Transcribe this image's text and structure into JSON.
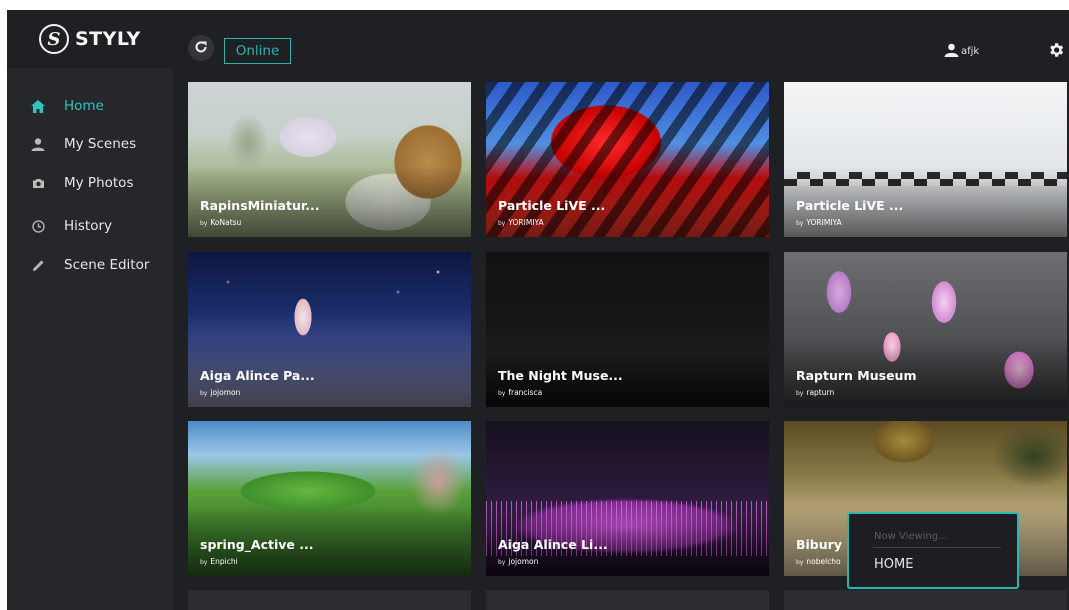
{
  "brand": {
    "logo_letter": "S",
    "name": "STYLY"
  },
  "sidebar": {
    "items": [
      {
        "label": "Home",
        "icon": "home-icon",
        "active": true
      },
      {
        "label": "My Scenes",
        "icon": "person-icon"
      },
      {
        "label": "My Photos",
        "icon": "camera-icon"
      },
      {
        "label": "History",
        "icon": "clock-icon"
      },
      {
        "label": "Scene Editor",
        "icon": "pencil-icon"
      }
    ]
  },
  "topbar": {
    "status": "Online",
    "username": "afjk"
  },
  "cards": [
    {
      "title": "RapinsMiniatur...",
      "by": "by",
      "author": "KoNatsu"
    },
    {
      "title": "Particle LiVE ...",
      "by": "by",
      "author": "YORIMIYA"
    },
    {
      "title": "Particle LiVE ...",
      "by": "by",
      "author": "YORIMIYA"
    },
    {
      "title": "Aiga Alince Pa...",
      "by": "by",
      "author": "jojomon"
    },
    {
      "title": "The Night Muse...",
      "by": "by",
      "author": "francisca"
    },
    {
      "title": "Rapturn Museum",
      "by": "by",
      "author": "rapturn"
    },
    {
      "title": "spring_Active ...",
      "by": "by",
      "author": "Enpichi"
    },
    {
      "title": "Aiga Alince Li...",
      "by": "by",
      "author": "jojomon"
    },
    {
      "title": "Bibury S",
      "by": "by",
      "author": "nobelcho"
    }
  ],
  "now_viewing": {
    "label": "Now Viewing...",
    "value": "HOME"
  },
  "colors": {
    "accent": "#2ec4bd",
    "background": "#1f2024",
    "sidebar": "#26272b"
  }
}
